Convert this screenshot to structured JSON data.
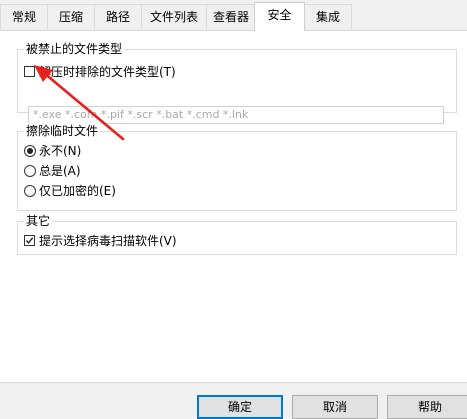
{
  "tabs": [
    {
      "label": "常规"
    },
    {
      "label": "压缩"
    },
    {
      "label": "路径"
    },
    {
      "label": "文件列表"
    },
    {
      "label": "查看器"
    },
    {
      "label": "安全",
      "active": true
    },
    {
      "label": "集成"
    }
  ],
  "blocked_types": {
    "title": "被禁止的文件类型",
    "checkbox_label": "解压时排除的文件类型(T)",
    "checked": false,
    "input_value": "*.exe *.com *.pif *.scr *.bat *.cmd *.lnk"
  },
  "wipe_temp": {
    "title": "擦除临时文件",
    "options": [
      {
        "label": "永不(N)",
        "selected": true
      },
      {
        "label": "总是(A)",
        "selected": false
      },
      {
        "label": "仅已加密的(E)",
        "selected": false
      }
    ]
  },
  "other": {
    "title": "其它",
    "checkbox_label": "提示选择病毒扫描软件(V)",
    "checked": true
  },
  "buttons": {
    "ok": "确定",
    "cancel": "取消",
    "help": "帮助"
  },
  "colors": {
    "annotation_arrow": "#e8201a",
    "default_button_border": "#0078d7"
  }
}
